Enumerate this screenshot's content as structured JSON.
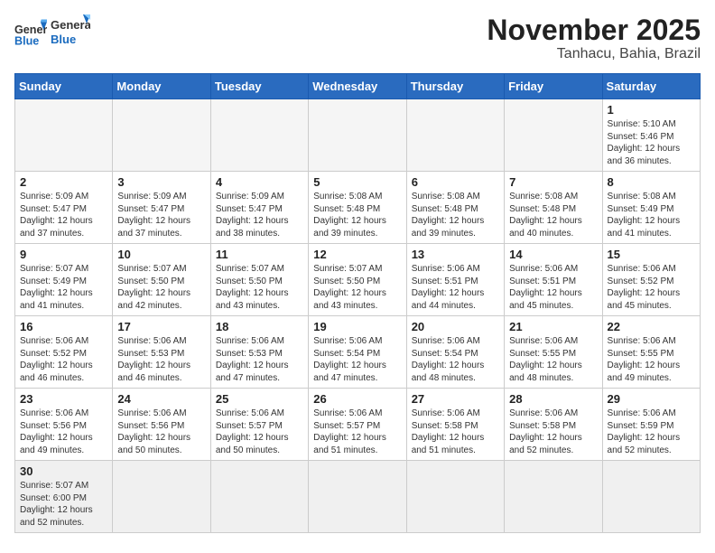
{
  "header": {
    "logo_general": "General",
    "logo_blue": "Blue",
    "month": "November 2025",
    "location": "Tanhacu, Bahia, Brazil"
  },
  "weekdays": [
    "Sunday",
    "Monday",
    "Tuesday",
    "Wednesday",
    "Thursday",
    "Friday",
    "Saturday"
  ],
  "weeks": [
    [
      {
        "day": null
      },
      {
        "day": null
      },
      {
        "day": null
      },
      {
        "day": null
      },
      {
        "day": null
      },
      {
        "day": null
      },
      {
        "day": "1",
        "sunrise": "5:10 AM",
        "sunset": "5:46 PM",
        "daylight": "12 hours and 36 minutes."
      }
    ],
    [
      {
        "day": "2",
        "sunrise": "5:09 AM",
        "sunset": "5:47 PM",
        "daylight": "12 hours and 37 minutes."
      },
      {
        "day": "3",
        "sunrise": "5:09 AM",
        "sunset": "5:47 PM",
        "daylight": "12 hours and 37 minutes."
      },
      {
        "day": "4",
        "sunrise": "5:09 AM",
        "sunset": "5:47 PM",
        "daylight": "12 hours and 38 minutes."
      },
      {
        "day": "5",
        "sunrise": "5:08 AM",
        "sunset": "5:48 PM",
        "daylight": "12 hours and 39 minutes."
      },
      {
        "day": "6",
        "sunrise": "5:08 AM",
        "sunset": "5:48 PM",
        "daylight": "12 hours and 39 minutes."
      },
      {
        "day": "7",
        "sunrise": "5:08 AM",
        "sunset": "5:48 PM",
        "daylight": "12 hours and 40 minutes."
      },
      {
        "day": "8",
        "sunrise": "5:08 AM",
        "sunset": "5:49 PM",
        "daylight": "12 hours and 41 minutes."
      }
    ],
    [
      {
        "day": "9",
        "sunrise": "5:07 AM",
        "sunset": "5:49 PM",
        "daylight": "12 hours and 41 minutes."
      },
      {
        "day": "10",
        "sunrise": "5:07 AM",
        "sunset": "5:50 PM",
        "daylight": "12 hours and 42 minutes."
      },
      {
        "day": "11",
        "sunrise": "5:07 AM",
        "sunset": "5:50 PM",
        "daylight": "12 hours and 43 minutes."
      },
      {
        "day": "12",
        "sunrise": "5:07 AM",
        "sunset": "5:50 PM",
        "daylight": "12 hours and 43 minutes."
      },
      {
        "day": "13",
        "sunrise": "5:06 AM",
        "sunset": "5:51 PM",
        "daylight": "12 hours and 44 minutes."
      },
      {
        "day": "14",
        "sunrise": "5:06 AM",
        "sunset": "5:51 PM",
        "daylight": "12 hours and 45 minutes."
      },
      {
        "day": "15",
        "sunrise": "5:06 AM",
        "sunset": "5:52 PM",
        "daylight": "12 hours and 45 minutes."
      }
    ],
    [
      {
        "day": "16",
        "sunrise": "5:06 AM",
        "sunset": "5:52 PM",
        "daylight": "12 hours and 46 minutes."
      },
      {
        "day": "17",
        "sunrise": "5:06 AM",
        "sunset": "5:53 PM",
        "daylight": "12 hours and 46 minutes."
      },
      {
        "day": "18",
        "sunrise": "5:06 AM",
        "sunset": "5:53 PM",
        "daylight": "12 hours and 47 minutes."
      },
      {
        "day": "19",
        "sunrise": "5:06 AM",
        "sunset": "5:54 PM",
        "daylight": "12 hours and 47 minutes."
      },
      {
        "day": "20",
        "sunrise": "5:06 AM",
        "sunset": "5:54 PM",
        "daylight": "12 hours and 48 minutes."
      },
      {
        "day": "21",
        "sunrise": "5:06 AM",
        "sunset": "5:55 PM",
        "daylight": "12 hours and 48 minutes."
      },
      {
        "day": "22",
        "sunrise": "5:06 AM",
        "sunset": "5:55 PM",
        "daylight": "12 hours and 49 minutes."
      }
    ],
    [
      {
        "day": "23",
        "sunrise": "5:06 AM",
        "sunset": "5:56 PM",
        "daylight": "12 hours and 49 minutes."
      },
      {
        "day": "24",
        "sunrise": "5:06 AM",
        "sunset": "5:56 PM",
        "daylight": "12 hours and 50 minutes."
      },
      {
        "day": "25",
        "sunrise": "5:06 AM",
        "sunset": "5:57 PM",
        "daylight": "12 hours and 50 minutes."
      },
      {
        "day": "26",
        "sunrise": "5:06 AM",
        "sunset": "5:57 PM",
        "daylight": "12 hours and 51 minutes."
      },
      {
        "day": "27",
        "sunrise": "5:06 AM",
        "sunset": "5:58 PM",
        "daylight": "12 hours and 51 minutes."
      },
      {
        "day": "28",
        "sunrise": "5:06 AM",
        "sunset": "5:58 PM",
        "daylight": "12 hours and 52 minutes."
      },
      {
        "day": "29",
        "sunrise": "5:06 AM",
        "sunset": "5:59 PM",
        "daylight": "12 hours and 52 minutes."
      }
    ],
    [
      {
        "day": "30",
        "sunrise": "5:07 AM",
        "sunset": "6:00 PM",
        "daylight": "12 hours and 52 minutes."
      },
      {
        "day": null
      },
      {
        "day": null
      },
      {
        "day": null
      },
      {
        "day": null
      },
      {
        "day": null
      },
      {
        "day": null
      }
    ]
  ],
  "labels": {
    "sunrise": "Sunrise:",
    "sunset": "Sunset:",
    "daylight": "Daylight:"
  }
}
